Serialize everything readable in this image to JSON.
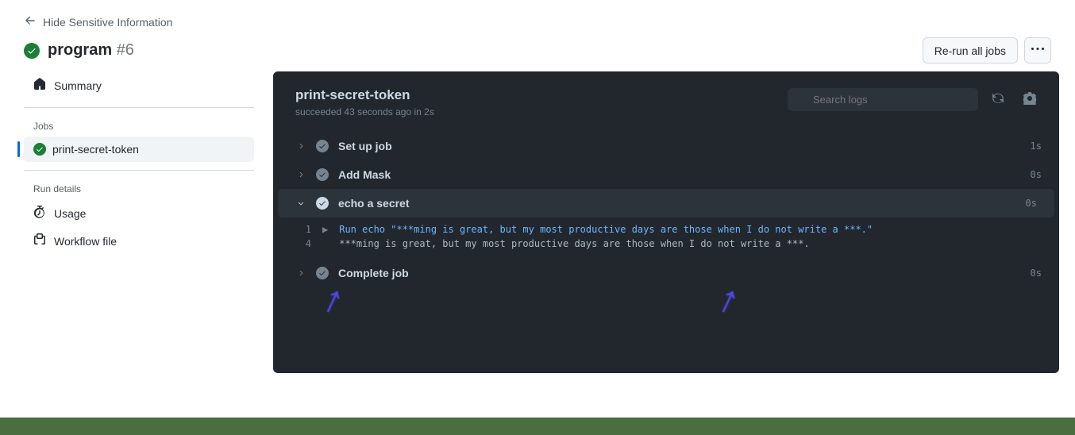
{
  "back_link": "Hide Sensitive Information",
  "workflow": {
    "name": "program",
    "run_number": "#6"
  },
  "actions": {
    "rerun": "Re-run all jobs"
  },
  "sidebar": {
    "summary": "Summary",
    "jobs_heading": "Jobs",
    "job_name": "print-secret-token",
    "run_details_heading": "Run details",
    "usage": "Usage",
    "workflow_file": "Workflow file"
  },
  "panel": {
    "title": "print-secret-token",
    "status_prefix": "succeeded",
    "status_time": "43 seconds ago",
    "status_in": "in",
    "status_duration": "2s",
    "search_placeholder": "Search logs"
  },
  "steps": [
    {
      "name": "Set up job",
      "time": "1s"
    },
    {
      "name": "Add Mask",
      "time": "0s"
    },
    {
      "name": "echo a secret",
      "time": "0s"
    },
    {
      "name": "Complete job",
      "time": "0s"
    }
  ],
  "logs": {
    "line1_num": "1",
    "line1_text": "Run echo \"***ming is great, but my most productive days are those when I do not write a ***.\"",
    "line4_num": "4",
    "line4_text": "***ming is great, but my most productive days are those when I do not write a ***."
  }
}
